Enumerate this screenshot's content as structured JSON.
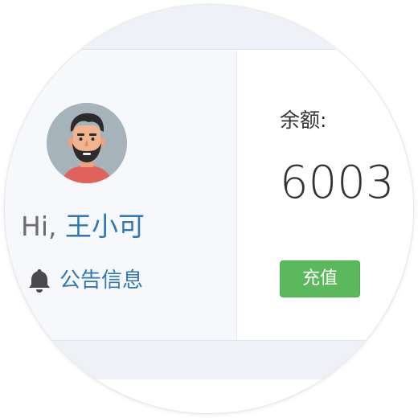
{
  "user": {
    "greeting_prefix": "Hi, ",
    "name": "王小可",
    "avatar_icon": "avatar-man-beard-icon"
  },
  "notice": {
    "icon": "bell-icon",
    "label": "公告信息"
  },
  "balance": {
    "label": "余额:",
    "value": "6003"
  },
  "actions": {
    "recharge_label": "充值"
  },
  "colors": {
    "link": "#2f78b5",
    "success_button": "#5cb85c",
    "panel_bg": "#f6f8fc",
    "band_bg": "#eef2f7",
    "avatar_bg": "#a6b3bb"
  }
}
